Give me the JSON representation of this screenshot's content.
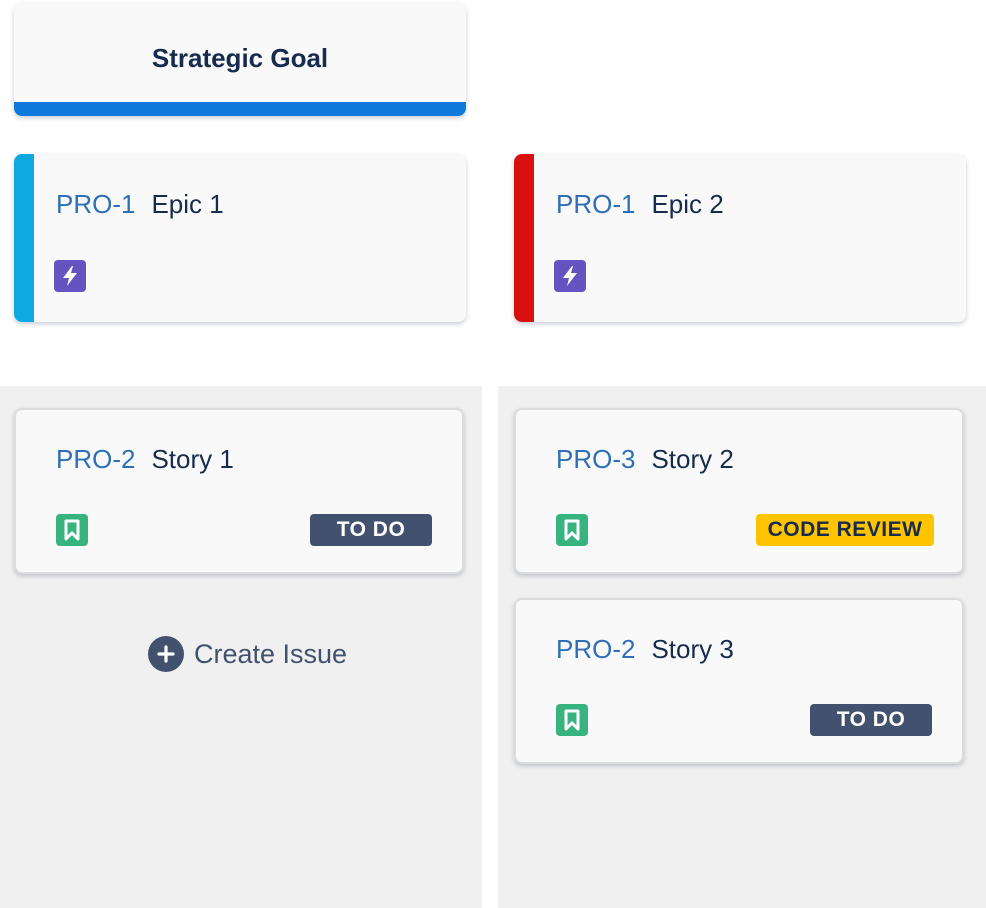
{
  "goal": {
    "title": "Strategic Goal",
    "accent_color": "#0f7ad9"
  },
  "epics": [
    {
      "key": "PRO-1",
      "summary": "Epic 1",
      "color": "#0ea9e0",
      "icon": "lightning-icon"
    },
    {
      "key": "PRO-1",
      "summary": "Epic 2",
      "color": "#d91010",
      "icon": "lightning-icon"
    }
  ],
  "stories": [
    {
      "key": "PRO-2",
      "summary": "Story 1",
      "status": "TO DO",
      "icon": "bookmark-icon"
    },
    {
      "key": "PRO-3",
      "summary": "Story 2",
      "status": "CODE REVIEW",
      "icon": "bookmark-icon"
    },
    {
      "key": "PRO-2",
      "summary": "Story 3",
      "status": "TO DO",
      "icon": "bookmark-icon"
    }
  ],
  "actions": {
    "create_issue": "Create Issue",
    "create_icon": "plus-circle-icon"
  },
  "colors": {
    "epic_icon_bg": "#6554c0",
    "story_icon_bg": "#36b37e",
    "status_todo_bg": "#42526e",
    "status_review_bg": "#ffc400",
    "issue_key": "#2e6fb7"
  }
}
